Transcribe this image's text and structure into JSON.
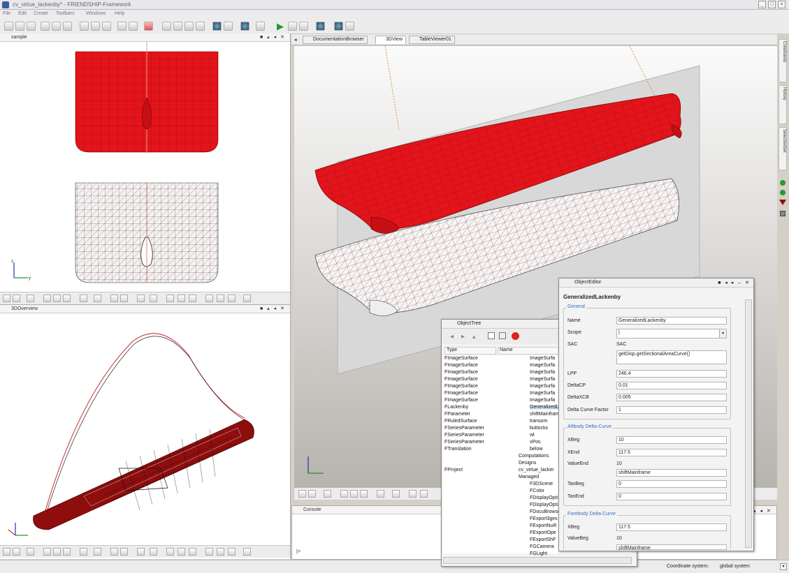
{
  "window": {
    "title": "cv_virtue_lackenby* - FRIENDSHIP-Framework"
  },
  "menu": [
    "File",
    "Edit",
    "Create",
    "Toolbars",
    "Windows",
    "Help"
  ],
  "panels": {
    "sample": "sample",
    "overview": "3DOverview"
  },
  "tabs": [
    {
      "label": "DocumentationBrowser"
    },
    {
      "label": "3DView"
    },
    {
      "label": "TableViewer01"
    }
  ],
  "side_tabs": [
    "Constraints",
    "History",
    "SelectionSet"
  ],
  "object_tree": {
    "title": "ObjectTree",
    "col_type": "Type",
    "col_name": "Name",
    "types": [
      "FImageSurface",
      "FImageSurface",
      "FImageSurface",
      "FImageSurface",
      "FImageSurface",
      "FImageSurface",
      "FImageSurface",
      "FLackenby",
      "FParameter",
      "FRuledSurface",
      "FSeriesParameter",
      "FSeriesParameter",
      "FSeriesParameter",
      "FTranslation",
      "",
      "",
      "FProject"
    ],
    "names": [
      "ImageSurfa",
      "ImageSurfa",
      "ImageSurfa",
      "ImageSurfa",
      "ImageSurfa",
      "ImageSurfa",
      "ImageSurfa",
      "GeneralizedL",
      "shiftMainfram",
      "transom",
      "buttocks",
      "wl",
      "xPos",
      "below",
      "Computations",
      "Designs",
      "cv_virtue_lacker",
      "Managed",
      "F3DScene",
      "FColor",
      "FDisplayOpti",
      "FDisplayOpti",
      "FDocuBrowse",
      "FExport3ges",
      "FExportNuR",
      "FExportOpe",
      "FExportShF",
      "FGCamera",
      "FGLight"
    ]
  },
  "object_editor": {
    "title": "ObjectEditor",
    "heading": "GeneralizedLackenby",
    "group_general": "General",
    "name_label": "Name",
    "name_value": "GeneralizedLackenby",
    "scope_label": "Scope",
    "scope_value": "|",
    "sac_label": "SAC",
    "sac_static": "SAC",
    "sac_value": "getDisp.getSectionalAreaCurve()",
    "lpp_label": "LPP",
    "lpp_value": "246.4",
    "deltacp_label": "DeltaCP",
    "deltacp_value": "0.01",
    "deltaxcb_label": "DeltaXCB",
    "deltaxcb_value": "0.005",
    "dcf_label": "Delta Curve Factor",
    "dcf_value": "1",
    "group_aft": "Aftbody Delta-Curve",
    "xbeg_label": "XBeg",
    "xbeg_value": "10",
    "xend_label": "XEnd",
    "xend_value": "117.5",
    "valueend_label": "ValueEnd",
    "valueend_value": "10",
    "shift_value": "shiftMainframe",
    "tanbeg_label": "TanBeg",
    "tanbeg_value": "0",
    "tanend_label": "TanEnd",
    "tanend_value": "0",
    "group_fore": "Forebody Delta-Curve",
    "fxbeg_label": "XBeg",
    "fxbeg_value": "117.5",
    "fvaluebeg_label": "ValueBeg",
    "fvaluebeg_value": "10",
    "fshift_value": "shiftMainframe"
  },
  "console": {
    "title": "Console",
    "prompt": "|>"
  },
  "status": {
    "coord_label": "Coordinate system:",
    "coord_value": "global system"
  },
  "colors": {
    "hull_red": "#e3141b",
    "accent": "#3a6bc4"
  }
}
